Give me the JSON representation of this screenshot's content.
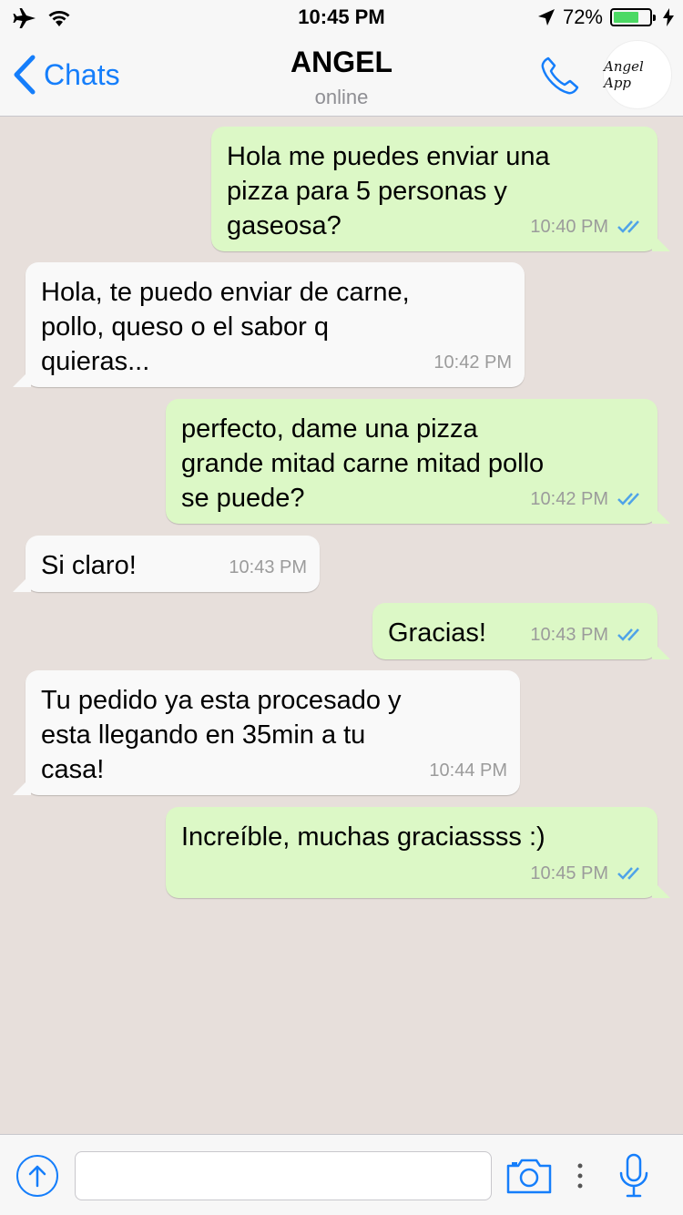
{
  "status_bar": {
    "time": "10:45 PM",
    "battery_percent": "72%",
    "battery_level": 0.72,
    "icons": [
      "airplane-icon",
      "wifi-icon",
      "location-arrow-icon",
      "battery-icon",
      "charging-bolt-icon"
    ]
  },
  "nav": {
    "back_label": "Chats",
    "title": "ANGEL",
    "subtitle": "online",
    "avatar_text": "Angel App"
  },
  "messages": [
    {
      "direction": "out",
      "text": "Hola me puedes enviar una\npizza para 5 personas y\ngaseosa?",
      "time": "10:40 PM",
      "read": true
    },
    {
      "direction": "in",
      "text": "Hola, te puedo enviar de carne,\npollo, queso o el sabor q\nquieras...",
      "time": "10:42 PM"
    },
    {
      "direction": "out",
      "text": "perfecto, dame una pizza\ngrande mitad carne mitad pollo\nse puede?",
      "time": "10:42 PM",
      "read": true
    },
    {
      "direction": "in",
      "text": "Si claro!",
      "time": "10:43 PM"
    },
    {
      "direction": "out",
      "text": "Gracias!",
      "time": "10:43 PM",
      "read": true
    },
    {
      "direction": "in",
      "text": "Tu pedido ya esta procesado y\nesta llegando en 35min a tu\ncasa!",
      "time": "10:44 PM"
    },
    {
      "direction": "out",
      "text": "Increíble, muchas graciassss :)",
      "time": "10:45 PM",
      "read": true
    }
  ],
  "input": {
    "value": "",
    "icons": [
      "send-arrow-icon",
      "camera-icon",
      "more-dots-icon",
      "microphone-icon"
    ]
  },
  "colors": {
    "accent": "#157efb",
    "outgoing_bubble": "#dcf8c6",
    "incoming_bubble": "#f9f9f9",
    "chat_background": "#e7dfdb",
    "read_ticks": "#4fa3e8"
  }
}
